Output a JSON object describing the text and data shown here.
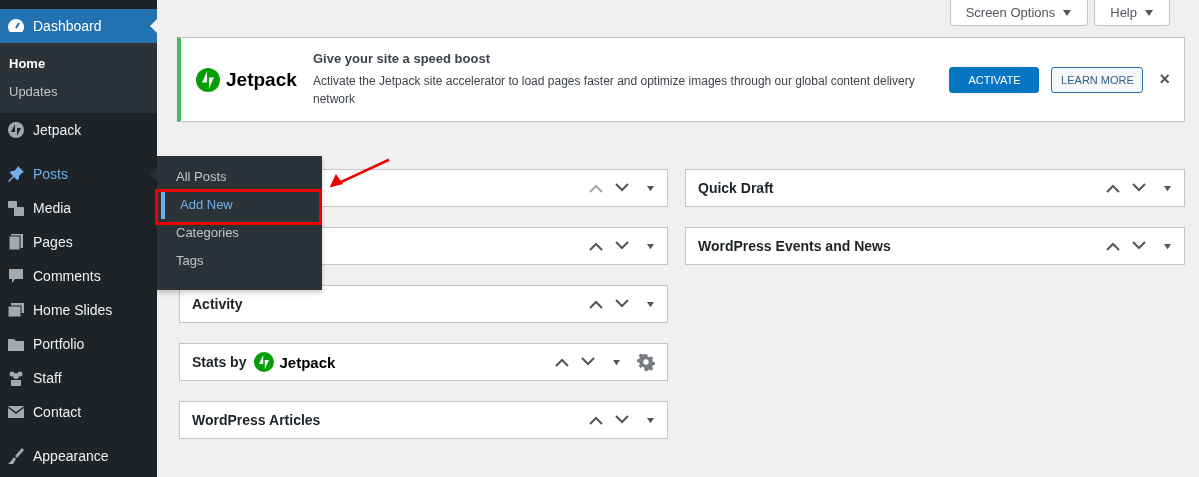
{
  "sidebar": {
    "groups": [
      {
        "items": [
          {
            "label": "Dashboard",
            "selected": true,
            "highlighted": false,
            "submenu": [
              {
                "label": "Home",
                "selected": true
              },
              {
                "label": "Updates",
                "selected": false
              }
            ]
          },
          {
            "label": "Jetpack",
            "selected": false,
            "highlighted": false
          }
        ]
      },
      {
        "items": [
          {
            "label": "Posts",
            "selected": false,
            "highlighted": true,
            "flyout": [
              {
                "label": "All Posts",
                "selected": false
              },
              {
                "label": "Add New",
                "selected": true
              },
              {
                "label": "Categories",
                "selected": false
              },
              {
                "label": "Tags",
                "selected": false
              }
            ]
          },
          {
            "label": "Media",
            "selected": false,
            "highlighted": false
          },
          {
            "label": "Pages",
            "selected": false,
            "highlighted": false
          },
          {
            "label": "Comments",
            "selected": false,
            "highlighted": false
          },
          {
            "label": "Home Slides",
            "selected": false,
            "highlighted": false
          },
          {
            "label": "Portfolio",
            "selected": false,
            "highlighted": false
          },
          {
            "label": "Staff",
            "selected": false,
            "highlighted": false
          },
          {
            "label": "Contact",
            "selected": false,
            "highlighted": false
          }
        ]
      },
      {
        "items": [
          {
            "label": "Appearance",
            "selected": false,
            "highlighted": false
          }
        ]
      }
    ]
  },
  "top_buttons": [
    {
      "label": "Screen Options"
    },
    {
      "label": "Help"
    }
  ],
  "notice": {
    "brand": "Jetpack",
    "title": "Give your site a speed boost",
    "text": "Activate the Jetpack site accelerator to load pages faster and optimize images through our global content delivery network",
    "buttons": [
      {
        "label": "ACTIVATE",
        "kind": "primary"
      },
      {
        "label": "LEARN MORE",
        "kind": "secondary"
      }
    ],
    "dismiss": "×"
  },
  "columns": [
    {
      "widgets": [
        {
          "up_disabled": true
        },
        {
          "up_disabled": false
        },
        {
          "title": "Activity",
          "up_disabled": false
        },
        {
          "title": "Stats by",
          "brand": "Jetpack",
          "up_disabled": false,
          "gear": true
        },
        {
          "title": "WordPress Articles",
          "up_disabled": false
        }
      ]
    },
    {
      "widgets": [
        {
          "title": "Quick Draft",
          "up_disabled": false
        },
        {
          "title": "WordPress Events and News",
          "up_disabled": false
        }
      ]
    }
  ]
}
